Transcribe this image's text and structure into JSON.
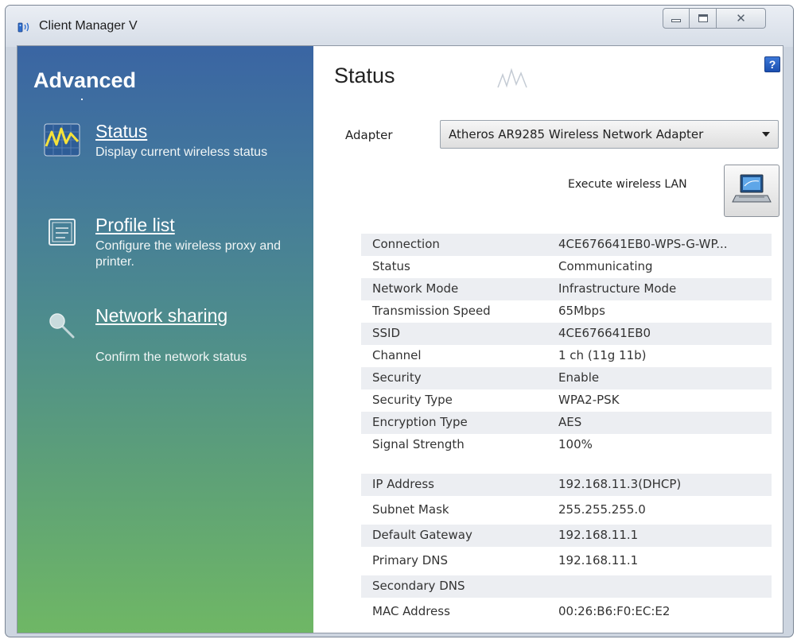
{
  "window": {
    "title": "Client Manager V"
  },
  "sidebar": {
    "heading": "Advanced",
    "items": [
      {
        "title": "Status",
        "description": "Display current wireless status",
        "icon": "status-signal-icon"
      },
      {
        "title": "Profile list",
        "description": "Configure the wireless proxy and printer.",
        "icon": "profile-list-icon"
      },
      {
        "title": "Network sharing",
        "description": "Confirm the network status",
        "icon": "magnifier-icon"
      }
    ]
  },
  "main": {
    "title": "Status",
    "help": "?",
    "adapter_label": "Adapter",
    "adapter_value": "Atheros AR9285 Wireless Network Adapter",
    "execute_label": "Execute wireless LAN",
    "wireless_info": [
      {
        "key": "Connection",
        "value": "4CE676641EB0-WPS-G-WP..."
      },
      {
        "key": "Status",
        "value": "Communicating"
      },
      {
        "key": "Network Mode",
        "value": "Infrastructure Mode"
      },
      {
        "key": "Transmission Speed",
        "value": "65Mbps"
      },
      {
        "key": "SSID",
        "value": "4CE676641EB0"
      },
      {
        "key": "Channel",
        "value": "1 ch (11g 11b)"
      },
      {
        "key": "Security",
        "value": "Enable"
      },
      {
        "key": "Security Type",
        "value": "WPA2-PSK"
      },
      {
        "key": "Encryption Type",
        "value": "AES"
      },
      {
        "key": "Signal Strength",
        "value": "100%"
      }
    ],
    "network_info": [
      {
        "key": "IP Address",
        "value": "192.168.11.3(DHCP)"
      },
      {
        "key": "Subnet Mask",
        "value": "255.255.255.0"
      },
      {
        "key": "Default Gateway",
        "value": "192.168.11.1"
      },
      {
        "key": "Primary DNS",
        "value": "192.168.11.1"
      },
      {
        "key": "Secondary DNS",
        "value": ""
      },
      {
        "key": "MAC Address",
        "value": "00:26:B6:F0:EC:E2"
      }
    ]
  },
  "colors": {
    "sidebar_top": "#3a65a3",
    "sidebar_bottom": "#6fb765",
    "row_shade": "#eceef2",
    "help_blue": "#1a4fb0"
  }
}
